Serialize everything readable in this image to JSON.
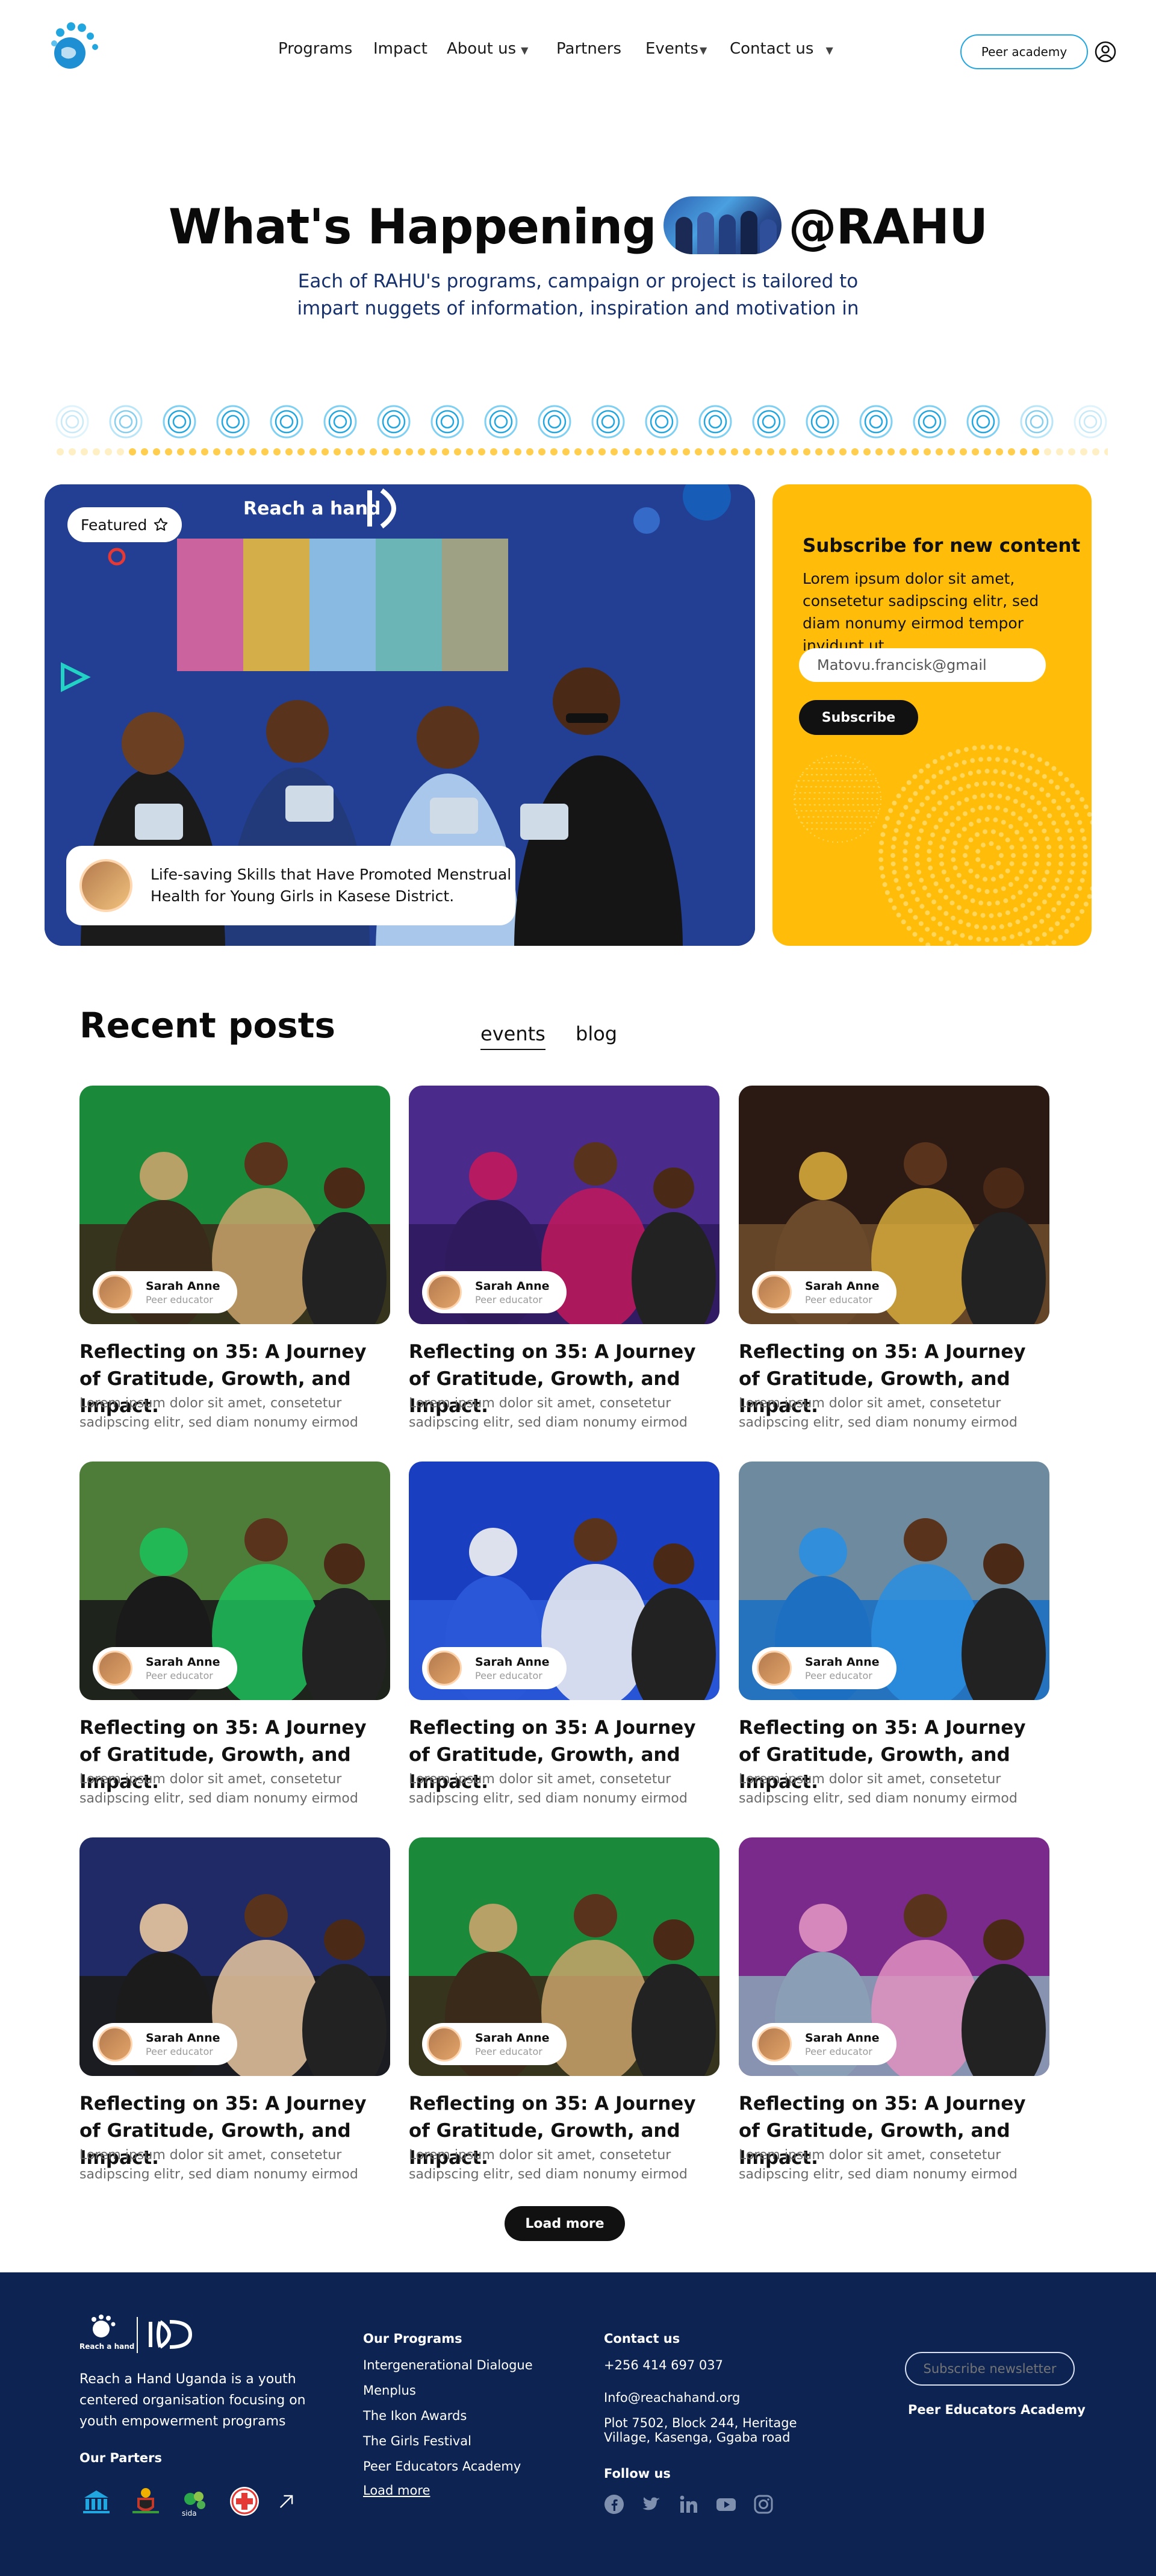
{
  "nav": {
    "links": [
      {
        "label": "Programs",
        "caret": false
      },
      {
        "label": "Impact",
        "caret": false
      },
      {
        "label": "About us",
        "caret": true
      },
      {
        "label": "Partners",
        "caret": false
      },
      {
        "label": "Events",
        "caret": true
      },
      {
        "label": "Contact us",
        "caret": true
      }
    ],
    "peer_academy_label": "Peer academy"
  },
  "hero": {
    "title_before": "What's Happening",
    "title_after": "@RAHU",
    "subtitle": "Each of RAHU's programs, campaign or project is tailored to impart nuggets of information, inspiration and motivation in"
  },
  "featured": {
    "chip_label": "Featured",
    "caption": "Life-saving Skills that Have Promoted Menstrual Health for Young Girls in Kasese District."
  },
  "subscribe": {
    "title": "Subscribe for new content",
    "text": "Lorem ipsum dolor sit amet, consetetur sadipscing elitr, sed diam nonumy eirmod tempor invidunt ut",
    "input_value": "Matovu.francisk@gmail",
    "button_label": "Subscribe"
  },
  "recent": {
    "title": "Recent posts",
    "tabs": [
      "events",
      "blog"
    ],
    "posts": [
      {
        "author": "Sarah Anne",
        "role": "Peer educator",
        "title": "Reflecting on 35: A Journey of Gratitude, Growth, and Impact.",
        "excerpt": "Lorem ipsum dolor sit amet, consetetur sadipscing elitr, sed diam nonumy eirmod"
      },
      {
        "author": "Sarah Anne",
        "role": "Peer educator",
        "title": "Reflecting on 35: A Journey of Gratitude, Growth, and Impact.",
        "excerpt": "Lorem ipsum dolor sit amet, consetetur sadipscing elitr, sed diam nonumy eirmod"
      },
      {
        "author": "Sarah Anne",
        "role": "Peer educator",
        "title": "Reflecting on 35: A Journey of Gratitude, Growth, and Impact.",
        "excerpt": "Lorem ipsum dolor sit amet, consetetur sadipscing elitr, sed diam nonumy eirmod"
      },
      {
        "author": "Sarah Anne",
        "role": "Peer educator",
        "title": "Reflecting on 35: A Journey of Gratitude, Growth, and Impact.",
        "excerpt": "Lorem ipsum dolor sit amet, consetetur sadipscing elitr, sed diam nonumy eirmod"
      },
      {
        "author": "Sarah Anne",
        "role": "Peer educator",
        "title": "Reflecting on 35: A Journey of Gratitude, Growth, and Impact.",
        "excerpt": "Lorem ipsum dolor sit amet, consetetur sadipscing elitr, sed diam nonumy eirmod"
      },
      {
        "author": "Sarah Anne",
        "role": "Peer educator",
        "title": "Reflecting on 35: A Journey of Gratitude, Growth, and Impact.",
        "excerpt": "Lorem ipsum dolor sit amet, consetetur sadipscing elitr, sed diam nonumy eirmod"
      },
      {
        "author": "Sarah Anne",
        "role": "Peer educator",
        "title": "Reflecting on 35: A Journey of Gratitude, Growth, and Impact.",
        "excerpt": "Lorem ipsum dolor sit amet, consetetur sadipscing elitr, sed diam nonumy eirmod"
      },
      {
        "author": "Sarah Anne",
        "role": "Peer educator",
        "title": "Reflecting on 35: A Journey of Gratitude, Growth, and Impact.",
        "excerpt": "Lorem ipsum dolor sit amet, consetetur sadipscing elitr, sed diam nonumy eirmod"
      },
      {
        "author": "Sarah Anne",
        "role": "Peer educator",
        "title": "Reflecting on 35: A Journey of Gratitude, Growth, and Impact.",
        "excerpt": "Lorem ipsum dolor sit amet, consetetur sadipscing elitr, sed diam nonumy eirmod"
      }
    ],
    "load_more_label": "Load more"
  },
  "footer": {
    "logo_text": "Reach a hand",
    "description": "Reach a Hand Uganda is a youth centered organisation focusing on youth empowerment programs",
    "partners_heading": "Our Parters",
    "programs_heading": "Our Programs",
    "programs": [
      "Intergenerational Dialogue",
      "Menplus",
      "The Ikon Awards",
      "The Girls Festival",
      "Peer Educators Academy"
    ],
    "programs_more": "Load more",
    "contact_heading": "Contact us",
    "phone": "+256 414 697 037",
    "email": "Info@reachahand.org",
    "address": "Plot 7502, Block 244, Heritage Village, Kasenga, Ggaba road",
    "follow_heading": "Follow us",
    "newsletter_placeholder": "Subscribe newsletter",
    "peer_academy": "Peer Educators Academy"
  },
  "colors": {
    "brand_blue": "#22a6e0",
    "navy": "#0d2453",
    "yellow": "#ffbd0a",
    "title_blue": "#16306b"
  },
  "icons": [
    "logo-hand-icon",
    "caret-down-icon",
    "user-icon",
    "star-icon",
    "arrow-up-right-icon",
    "facebook-icon",
    "twitter-icon",
    "linkedin-icon",
    "youtube-icon",
    "instagram-icon"
  ]
}
